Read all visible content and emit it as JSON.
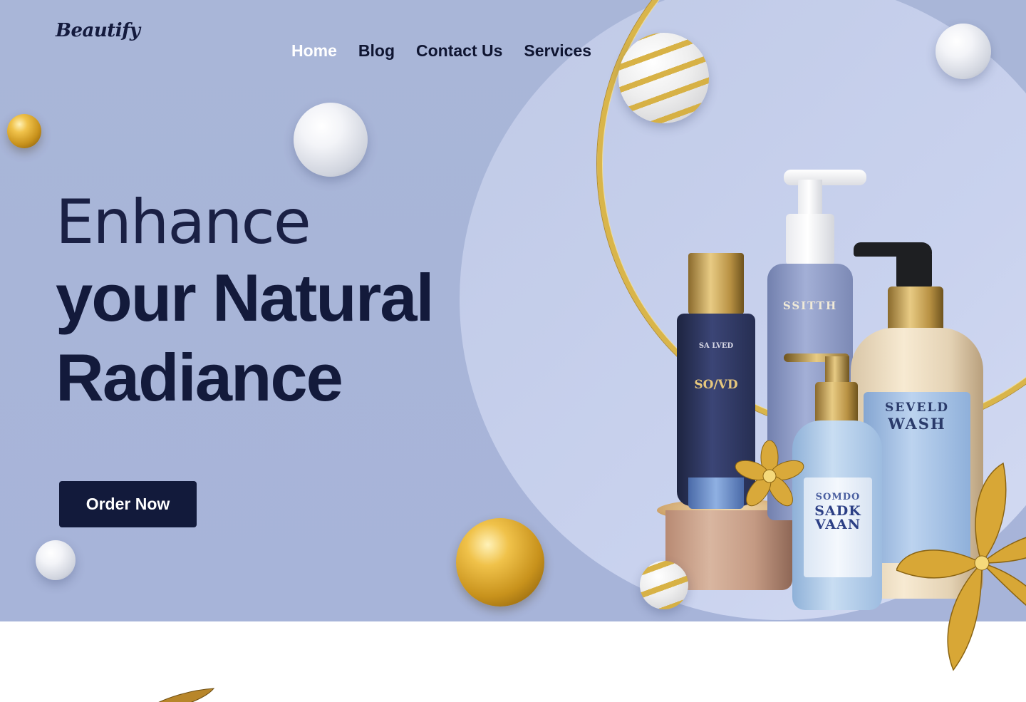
{
  "brand": {
    "logo_text": "Beautify"
  },
  "nav": {
    "items": [
      {
        "label": "Home",
        "active": true
      },
      {
        "label": "Blog",
        "active": false
      },
      {
        "label": "Contact Us",
        "active": false
      },
      {
        "label": "Services",
        "active": false
      }
    ]
  },
  "hero": {
    "headline_line1": "Enhance",
    "headline_line2": "your Natural",
    "headline_line3": "Radiance",
    "cta_label": "Order Now"
  },
  "products": {
    "tube_brand": "SO/VD",
    "tube_sub": "SA LVED",
    "tall_brand": "SSITTH",
    "round_brand_line1": "SEVELD",
    "round_brand_line2": "WASH",
    "small_brand_line1": "SOMDO",
    "small_brand_line2": "SADK VAAN"
  },
  "colors": {
    "hero_bg": "#a9b6d8",
    "navy": "#121a3b",
    "gold": "#d9b54a",
    "active_nav": "#ffffff"
  }
}
